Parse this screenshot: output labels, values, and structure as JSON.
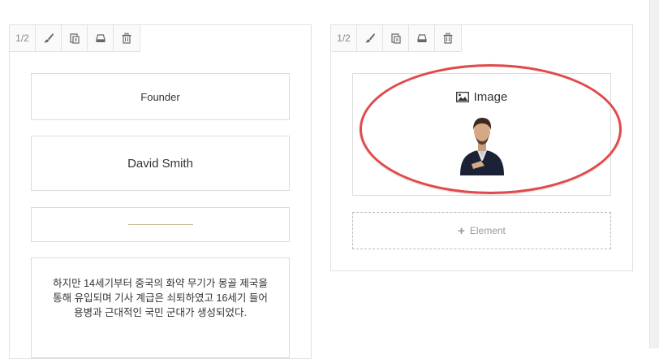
{
  "columns": [
    {
      "size_label": "1/2",
      "elements": {
        "founder": "Founder",
        "name": "David Smith",
        "text": "하지만 14세기부터 중국의 화약 무기가 몽골 제국을 통해 유입되며 기사 계급은 쇠퇴하였고 16세기 들어 용병과 근대적인 국민 군대가 생성되었다."
      }
    },
    {
      "size_label": "1/2",
      "elements": {
        "image_label": "Image"
      },
      "add_element_label": "Element"
    }
  ],
  "toolbar_icons": [
    "brush-icon",
    "paste-icon",
    "save-icon",
    "trash-icon"
  ],
  "colors": {
    "highlight": "#e04a4a",
    "divider": "#c9b793",
    "border": "#dcdcdc"
  }
}
